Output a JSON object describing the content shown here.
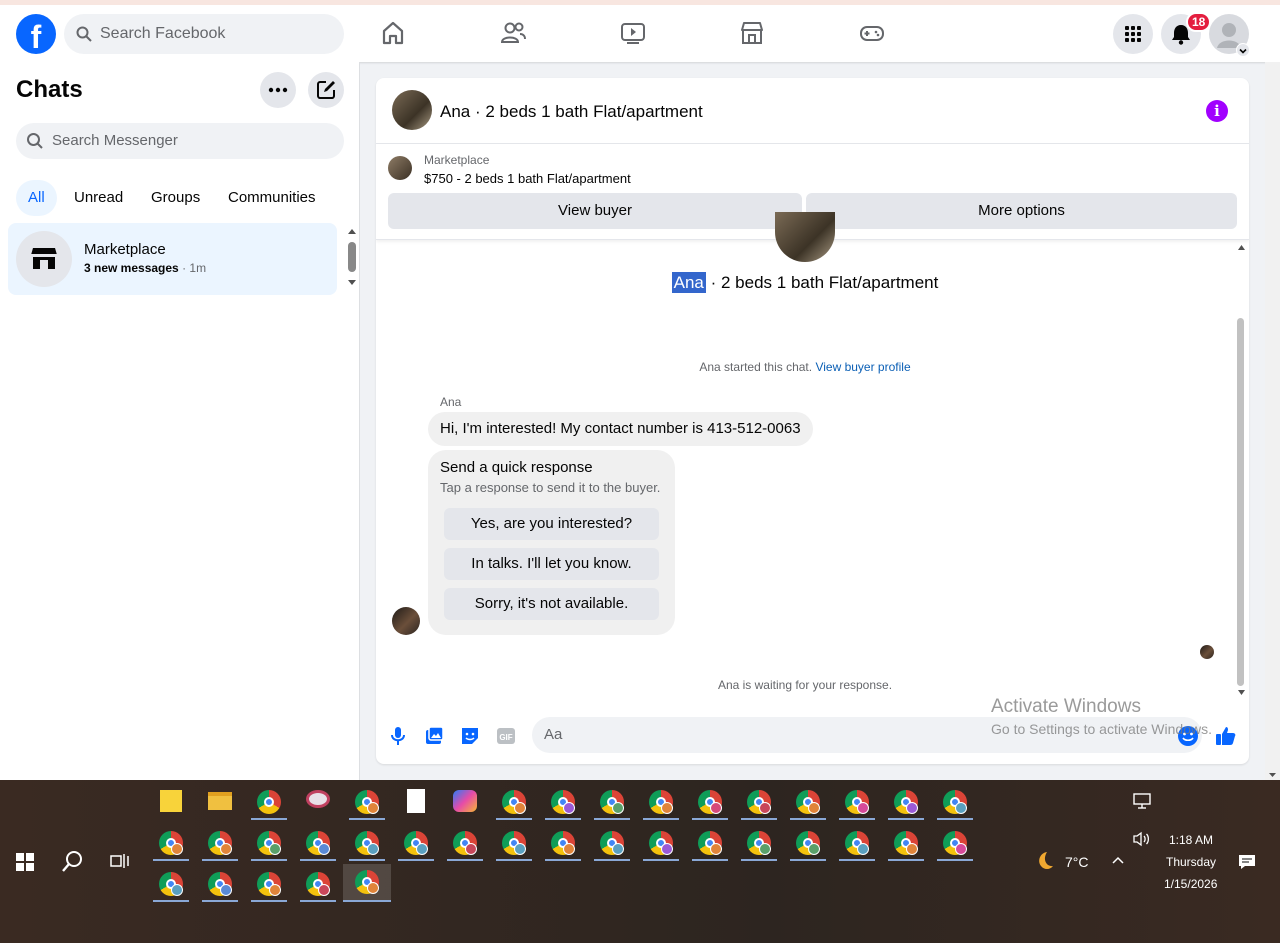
{
  "topbar": {
    "logo": "f",
    "search_placeholder": "Search Facebook",
    "notifications_count": "18",
    "nav_icons": [
      "home-icon",
      "friends-icon",
      "video-icon",
      "marketplace-icon",
      "gaming-icon"
    ]
  },
  "left": {
    "title": "Chats",
    "search_placeholder": "Search Messenger",
    "tabs": [
      "All",
      "Unread",
      "Groups",
      "Communities"
    ],
    "chat": {
      "name": "Marketplace",
      "subtitle": "3 new messages",
      "time": "· 1m"
    }
  },
  "conversation": {
    "header_title": "Ana · 2 beds 1 bath Flat/apartment",
    "marketplace_label": "Marketplace",
    "listing": "$750 - 2 beds 1 bath Flat/apartment",
    "view_buyer": "View buyer",
    "more_options": "More options",
    "title_name": "Ana",
    "title_rest": " · 2 beds 1 bath Flat/apartment",
    "started_text": "Ana started this chat.",
    "view_profile": "View buyer profile",
    "sender": "Ana",
    "message": "Hi, I'm interested! My contact number is 413-512-0063",
    "quick_title": "Send a quick response",
    "quick_sub": "Tap a response to send it to the buyer.",
    "quick_responses": [
      "Yes, are you interested?",
      "In talks. I'll let you know.",
      "Sorry, it's not available."
    ],
    "waiting": "Ana is waiting for your response.",
    "composer_placeholder": "Aa"
  },
  "watermark": {
    "line1": "Activate Windows",
    "line2": "Go to Settings to activate Windows."
  },
  "taskbar": {
    "weather": "7°C",
    "time": "1:18 AM",
    "day": "Thursday",
    "date": "1/15/2026"
  },
  "colors": {
    "accent": "#0866ff",
    "badge": "#e41e3f",
    "info": "#a100ff"
  }
}
